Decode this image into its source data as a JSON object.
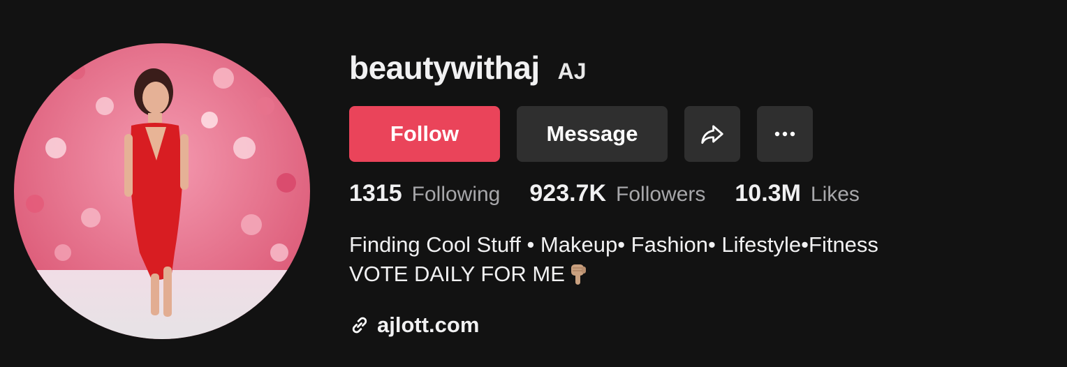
{
  "profile": {
    "username": "beautywithaj",
    "nickname": "AJ",
    "avatar_icon": "profile-photo"
  },
  "actions": {
    "follow_label": "Follow",
    "message_label": "Message",
    "share_icon": "share-arrow-icon",
    "more_icon": "more-dots-icon"
  },
  "stats": {
    "following_count": "1315",
    "following_label": "Following",
    "followers_count": "923.7K",
    "followers_label": "Followers",
    "likes_count": "10.3M",
    "likes_label": "Likes"
  },
  "bio": {
    "line1": "Finding Cool Stuff • Makeup• Fashion• Lifestyle•Fitness",
    "line2": "VOTE DAILY FOR ME",
    "line2_emoji": "pointing-down-hand-emoji"
  },
  "link": {
    "icon": "link-chain-icon",
    "text": "ajlott.com"
  },
  "colors": {
    "background": "#121212",
    "follow_button": "#ea445a",
    "secondary_button": "#2f2f2f",
    "muted_text": "#a7a7aa"
  }
}
